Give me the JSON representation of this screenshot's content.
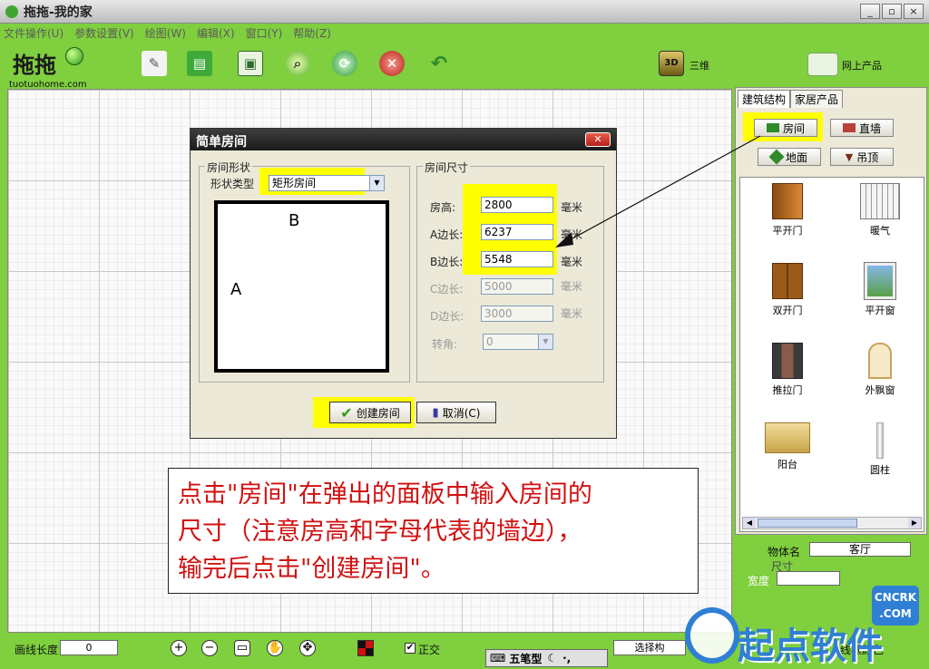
{
  "window": {
    "title": "拖拖-我的家",
    "controls": [
      "_",
      "▫",
      "×"
    ]
  },
  "menu": [
    "文件操作(U)",
    "参数设置(V)",
    "绘图(W)",
    "编辑(X)",
    "窗口(Y)",
    "帮助(Z)"
  ],
  "logo": {
    "mark": "拖拖",
    "url": "tuotuohome.com"
  },
  "toolbar": {
    "three_d_label": "三维",
    "three_d_icon_text": "3D",
    "online_label": "网上产品"
  },
  "panel": {
    "tabs": [
      "建筑结构",
      "家居产品"
    ],
    "buttons": {
      "room": "房间",
      "wall": "直墙",
      "floor": "地面",
      "ceiling": "吊顶"
    },
    "items": [
      "平开门",
      "暖气",
      "双开门",
      "平开窗",
      "推拉门",
      "外飘窗",
      "阳台",
      "圆柱"
    ]
  },
  "props": {
    "name_label": "物体名",
    "name_value": "客厅",
    "size_label": "尺寸",
    "width_label": "宽度"
  },
  "statusbar": {
    "line_length_label": "画线长度",
    "line_length_value": "0",
    "ortho_label": "正交",
    "select_label": "选择构",
    "frame_color_label": "线框颜色",
    "ime_label": "五笔型"
  },
  "dialog": {
    "title": "简单房间",
    "shape_group": "房间形状",
    "shape_type_label": "形状类型",
    "shape_type_value": "矩形房间",
    "preview_label_b": "B",
    "preview_label_a": "A",
    "size_group": "房间尺寸",
    "fields": [
      {
        "label": "房高:",
        "value": "2800",
        "unit": "毫米",
        "enabled": true
      },
      {
        "label": "A边长:",
        "value": "6237",
        "unit": "毫米",
        "enabled": true
      },
      {
        "label": "B边长:",
        "value": "5548",
        "unit": "毫米",
        "enabled": true
      },
      {
        "label": "C边长:",
        "value": "5000",
        "unit": "毫米",
        "enabled": false
      },
      {
        "label": "D边长:",
        "value": "3000",
        "unit": "毫米",
        "enabled": false
      }
    ],
    "angle_label": "转角:",
    "angle_value": "0",
    "create_button": "创建房间",
    "cancel_button": "取消(C)"
  },
  "note": {
    "lines": [
      "点击\"房间\"在弹出的面板中输入房间的",
      "尺寸（注意房高和字母代表的墙边），",
      "输完后点击\"创建房间\"。"
    ]
  },
  "watermark": {
    "text": "起点软件",
    "badge_top": "CNCRK",
    "badge_bottom": ".COM"
  },
  "colors": {
    "accent_green": "#7fcf3f",
    "highlight": "#ffff00",
    "note_red": "#d11010",
    "watermark_blue": "#2f7fd4"
  }
}
